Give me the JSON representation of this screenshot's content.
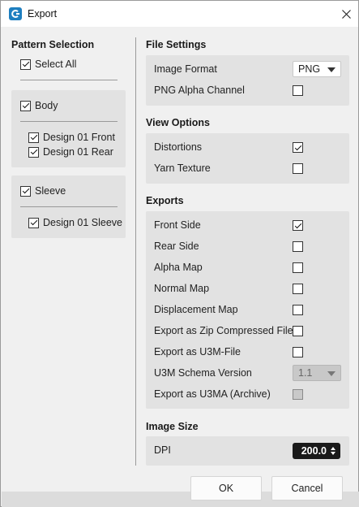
{
  "window": {
    "title": "Export",
    "close_glyph": "✕"
  },
  "pattern_selection": {
    "title": "Pattern Selection",
    "select_all": {
      "label": "Select All",
      "checked": true
    },
    "groups": [
      {
        "label": "Body",
        "checked": true,
        "children": [
          {
            "label": "Design 01 Front",
            "checked": true
          },
          {
            "label": "Design 01 Rear",
            "checked": true
          }
        ]
      },
      {
        "label": "Sleeve",
        "checked": true,
        "children": [
          {
            "label": "Design 01 Sleeve",
            "checked": true
          }
        ]
      }
    ]
  },
  "file_settings": {
    "title": "File Settings",
    "image_format": {
      "label": "Image Format",
      "value": "PNG"
    },
    "png_alpha": {
      "label": "PNG Alpha Channel",
      "checked": false
    }
  },
  "view_options": {
    "title": "View Options",
    "distortions": {
      "label": "Distortions",
      "checked": true
    },
    "yarn_texture": {
      "label": "Yarn Texture",
      "checked": false
    }
  },
  "exports": {
    "title": "Exports",
    "front_side": {
      "label": "Front Side",
      "checked": true
    },
    "rear_side": {
      "label": "Rear Side",
      "checked": false
    },
    "alpha_map": {
      "label": "Alpha Map",
      "checked": false
    },
    "normal_map": {
      "label": "Normal Map",
      "checked": false
    },
    "displacement_map": {
      "label": "Displacement Map",
      "checked": false
    },
    "zip": {
      "label": "Export as Zip Compressed File",
      "checked": false
    },
    "u3m_file": {
      "label": "Export as U3M-File",
      "checked": false
    },
    "u3m_schema": {
      "label": "U3M Schema Version",
      "value": "1.1",
      "disabled": true
    },
    "u3ma": {
      "label": "Export as U3MA (Archive)",
      "checked": false,
      "disabled": true
    }
  },
  "image_size": {
    "title": "Image Size",
    "dpi": {
      "label": "DPI",
      "value": "200.0"
    }
  },
  "buttons": {
    "ok": "OK",
    "cancel": "Cancel"
  },
  "colors": {
    "app_icon": "#1e7fc0",
    "panel": "#e2e2e2",
    "background": "#f0f0f0",
    "spin_bg": "#1a1a1a"
  }
}
